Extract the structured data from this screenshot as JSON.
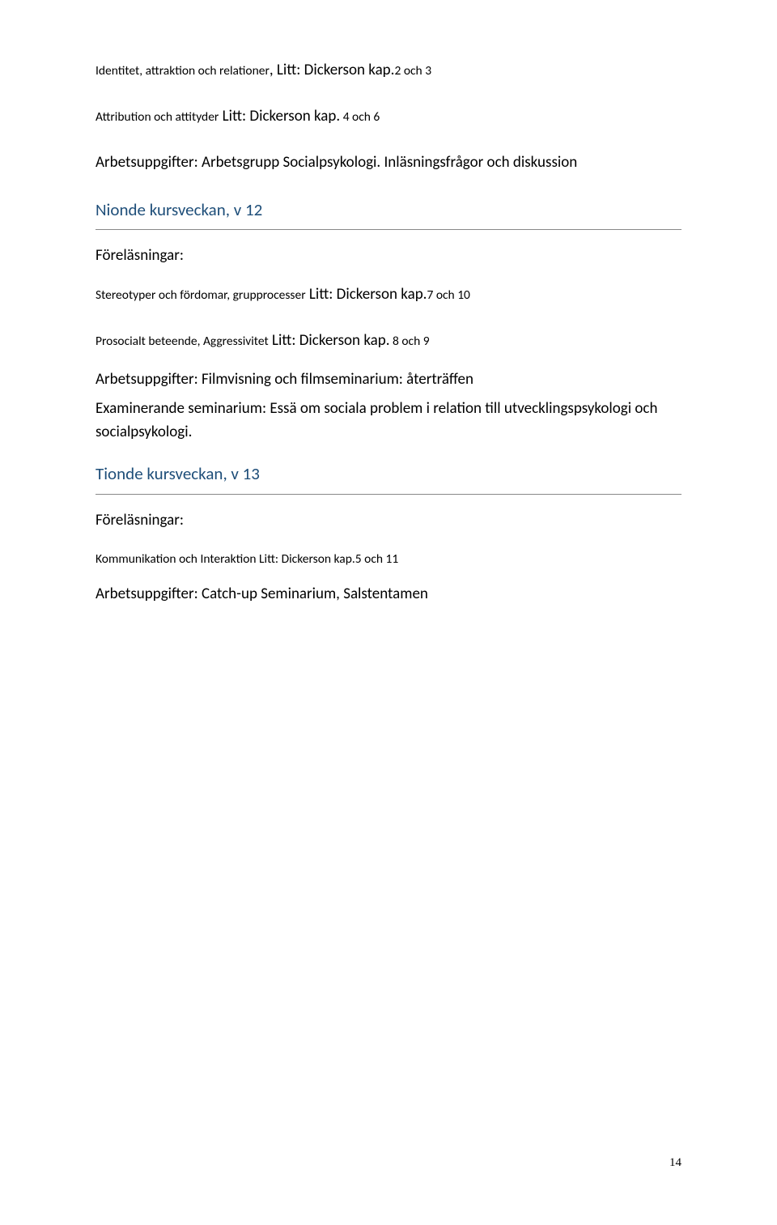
{
  "line1a": "Identitet, attraktion och relationer",
  "line1b": ", Litt: Dickerson kap.",
  "line1c": "2 och 3",
  "line2a": "Attribution och attityder",
  "line2b": " Litt: Dickerson kap.",
  "line2c": " 4 och 6",
  "line3": "Arbetsuppgifter: Arbetsgrupp Socialpsykologi. Inläsningsfrågor och diskussion",
  "heading1": "Nionde kursveckan, v 12",
  "forelasningar": "Föreläsningar:",
  "line4a": "Stereotyper och fördomar, grupprocesser",
  "line4b": " Litt: Dickerson kap.",
  "line4c": "7 och 10",
  "line5a": "Prosocialt beteende, Aggressivitet",
  "line5b": " Litt: Dickerson kap.",
  "line5c": " 8 och 9",
  "line6": "Arbetsuppgifter: Filmvisning och filmseminarium: återträffen",
  "line7": "Examinerande seminarium: Essä om sociala problem i relation till utvecklingspsykologi och socialpsykologi.",
  "heading2": "Tionde kursveckan, v 13",
  "line8a": "Kommunikation och Interaktion Litt: Dickerson kap.",
  "line8b": "5 och 11",
  "line9": "Arbetsuppgifter: Catch-up Seminarium, Salstentamen",
  "pagenum": "14"
}
